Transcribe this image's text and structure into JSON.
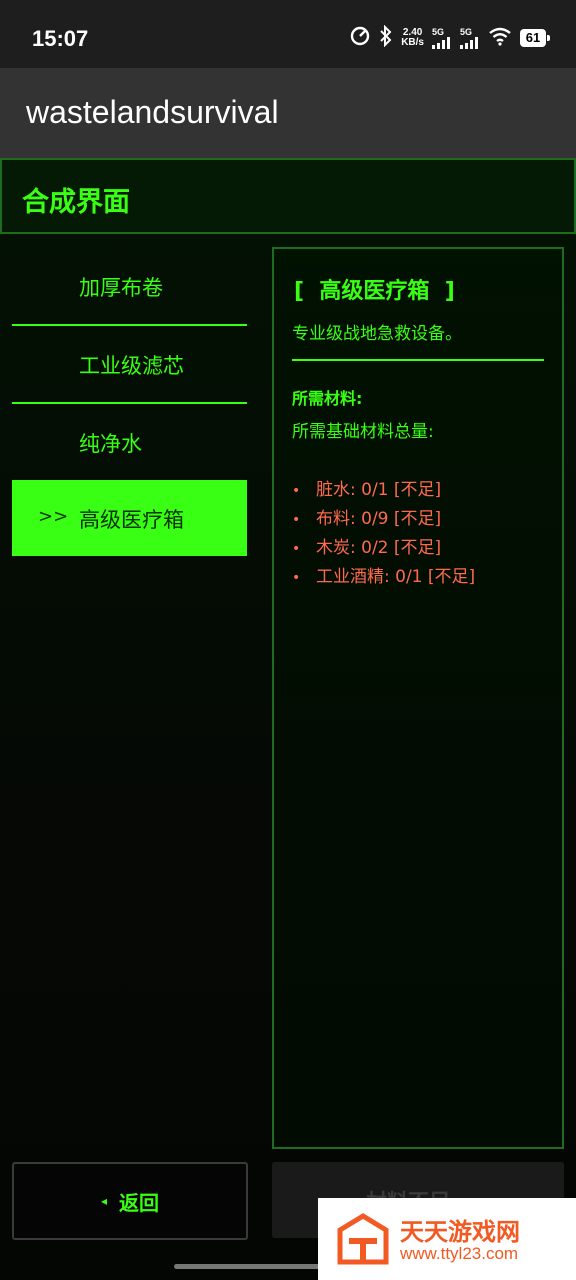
{
  "status_bar": {
    "time": "15:07",
    "net_speed_value": "2.40",
    "net_speed_unit": "KB/s",
    "signal_1": "5G",
    "signal_2": "5G",
    "battery": "61"
  },
  "app_bar": {
    "title": "wastelandsurvival"
  },
  "header": {
    "title": "合成界面"
  },
  "menu": {
    "items": [
      {
        "label": "加厚布卷",
        "marker": "",
        "active": false
      },
      {
        "label": "工业级滤芯",
        "marker": "",
        "active": false
      },
      {
        "label": "纯净水",
        "marker": "",
        "active": false
      },
      {
        "label": "高级医疗箱",
        "marker": ">>",
        "active": true
      }
    ]
  },
  "detail": {
    "title": "[  高级医疗箱  ]",
    "description": "专业级战地急救设备。",
    "requirements_title": "所需材料:",
    "requirements_subtitle": "所需基础材料总量:",
    "bullet": "•",
    "materials": [
      {
        "text": "脏水: 0/1 [不足]"
      },
      {
        "text": "布料: 0/9 [不足]"
      },
      {
        "text": "木炭: 0/2 [不足]"
      },
      {
        "text": "工业酒精: 0/1 [不足]"
      }
    ]
  },
  "buttons": {
    "back_arrow": "◂",
    "back_label": "返回",
    "craft_label": "材料不足"
  },
  "watermark": {
    "title": "天天游戏网",
    "url": "www.ttyl23.com"
  },
  "colors": {
    "accent": "#39ff14",
    "warning": "#ff6a4d",
    "watermark": "#f15a22"
  }
}
